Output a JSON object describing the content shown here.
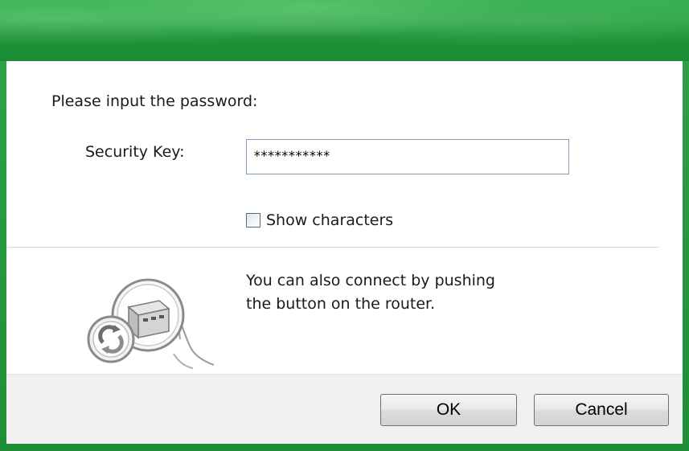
{
  "window": {
    "accent_color": "#1f9a3a"
  },
  "form": {
    "prompt": "Please input the password:",
    "security_key_label": "Security Key:",
    "security_key_value": "***********",
    "show_characters_label": "Show characters",
    "show_characters_checked": false
  },
  "wps": {
    "icon": "router-push-button-icon",
    "text_line1": "You can also connect by pushing",
    "text_line2": "the button on the router."
  },
  "buttons": {
    "ok_label": "OK",
    "cancel_label": "Cancel"
  }
}
